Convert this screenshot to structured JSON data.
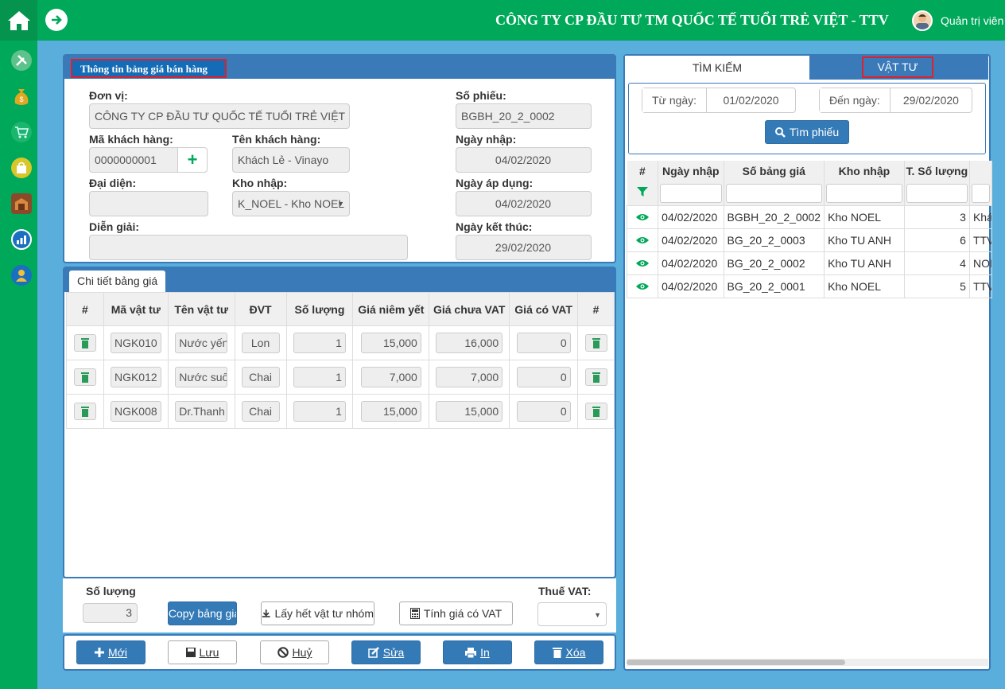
{
  "header": {
    "company": "CÔNG TY CP ĐẦU TƯ TM QUỐC TẾ TUỔI TRẺ VIỆT - TTV",
    "user": "Quản trị viên"
  },
  "sidebar": {
    "icons": [
      "tools-icon",
      "money-bag-icon",
      "cart-icon",
      "shopping-bag-icon",
      "warehouse-icon",
      "report-chart-icon",
      "user-group-icon"
    ]
  },
  "info": {
    "title": "Thông tin bảng giá bán hàng",
    "don_vi_label": "Đơn vị:",
    "don_vi": "CÔNG TY CP ĐẦU TƯ QUỐC TẾ TUỔI TRẺ VIỆT",
    "ma_kh_label": "Mã khách hàng:",
    "ma_kh": "0000000001",
    "ten_kh_label": "Tên khách hàng:",
    "ten_kh": "Khách Lẻ - Vinayo",
    "dai_dien_label": "Đại diện:",
    "dai_dien": "",
    "kho_nhap_label": "Kho nhập:",
    "kho_nhap": "K_NOEL - Kho NOEL",
    "dien_giai_label": "Diễn giải:",
    "dien_giai": "",
    "so_phieu_label": "Số phiếu:",
    "so_phieu": "BGBH_20_2_0002",
    "ngay_nhap_label": "Ngày nhập:",
    "ngay_nhap": "04/02/2020",
    "ngay_ap_dung_label": "Ngày áp dụng:",
    "ngay_ap_dung": "04/02/2020",
    "ngay_ket_thuc_label": "Ngày kết thúc:",
    "ngay_ket_thuc": "29/02/2020"
  },
  "detail": {
    "tab": "Chi tiết bảng giá",
    "columns": [
      "#",
      "Mã vật tư",
      "Tên vật tư",
      "ĐVT",
      "Số lượng",
      "Giá niêm yết",
      "Giá chưa VAT",
      "Giá có VAT",
      "#"
    ],
    "rows": [
      {
        "ma": "NGK010",
        "ten": "Nước yến",
        "dvt": "Lon",
        "sl": "1",
        "niem_yet": "15,000",
        "chua_vat": "16,000",
        "co_vat": "0"
      },
      {
        "ma": "NGK012",
        "ten": "Nước suối",
        "dvt": "Chai",
        "sl": "1",
        "niem_yet": "7,000",
        "chua_vat": "7,000",
        "co_vat": "0"
      },
      {
        "ma": "NGK008",
        "ten": "Dr.Thanh",
        "dvt": "Chai",
        "sl": "1",
        "niem_yet": "15,000",
        "chua_vat": "15,000",
        "co_vat": "0"
      }
    ]
  },
  "footer": {
    "so_luong_label": "Số lượng",
    "so_luong": "3",
    "copy": "Copy bảng giá",
    "lay_het": "Lấy hết vật tư nhóm",
    "tinh_gia": "Tính giá có VAT",
    "thue_vat_label": "Thuế VAT:",
    "thue_vat": ""
  },
  "actions": {
    "moi": "Mới",
    "luu": "Lưu",
    "huy": "Huỷ",
    "sua": "Sửa",
    "in": "In",
    "xoa": "Xóa"
  },
  "right": {
    "tab_search": "TÌM KIẾM",
    "tab_vattu": "VẬT TƯ",
    "tu_ngay_label": "Từ ngày:",
    "tu_ngay": "01/02/2020",
    "den_ngay_label": "Đến ngày:",
    "den_ngay": "29/02/2020",
    "tim_phieu": "Tìm phiếu",
    "columns": [
      "#",
      "Ngày nhập",
      "Số bảng giá",
      "Kho nhập",
      "T. Số lượng",
      ""
    ],
    "rows": [
      {
        "ngay": "04/02/2020",
        "so": "BGBH_20_2_0002",
        "kho": "Kho NOEL",
        "sl": "3",
        "extra": "Khách"
      },
      {
        "ngay": "04/02/2020",
        "so": "BG_20_2_0003",
        "kho": "Kho TU ANH",
        "sl": "6",
        "extra": "TTV"
      },
      {
        "ngay": "04/02/2020",
        "so": "BG_20_2_0002",
        "kho": "Kho TU ANH",
        "sl": "4",
        "extra": "NOEL"
      },
      {
        "ngay": "04/02/2020",
        "so": "BG_20_2_0001",
        "kho": "Kho NOEL",
        "sl": "5",
        "extra": "TTV"
      }
    ]
  }
}
